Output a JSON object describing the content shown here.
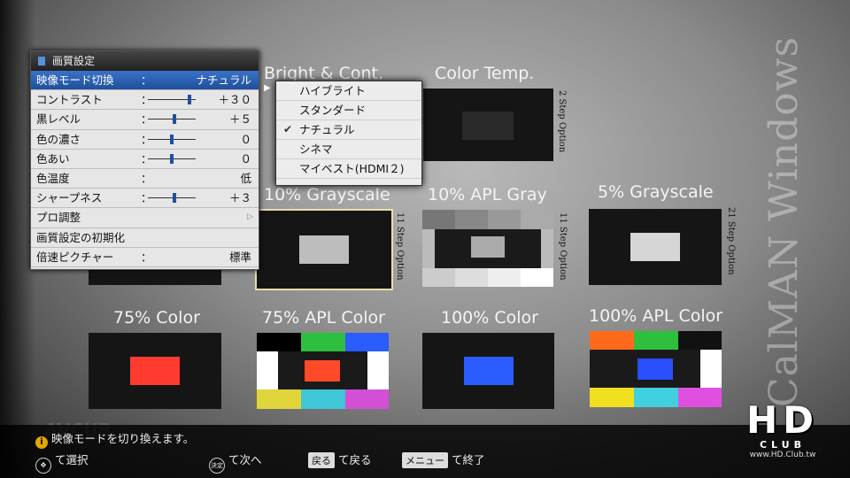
{
  "watermark": "CalMAN Windows",
  "patterns": [
    {
      "title": "Bright & Cont.",
      "option": ""
    },
    {
      "title": "Color Temp.",
      "option": "2 Step Option"
    },
    {
      "title": "10% Grayscale",
      "option": "11 Step Option"
    },
    {
      "title": "10% APL Gray",
      "option": "11 Step Option"
    },
    {
      "title": "5% Grayscale",
      "option": "21 Step Option"
    },
    {
      "title": "75% Color",
      "option": ""
    },
    {
      "title": "75% APL Color",
      "option": ""
    },
    {
      "title": "100% Color",
      "option": ""
    },
    {
      "title": "100% APL Color",
      "option": ""
    }
  ],
  "menu": {
    "title": "画質設定",
    "items": [
      {
        "label": "映像モード切換",
        "colon": "：",
        "value": "ナチュラル",
        "selected": true
      },
      {
        "label": "コントラスト",
        "colon": "：",
        "value": "＋３０",
        "slider": 0.9
      },
      {
        "label": "黒レベル",
        "colon": "：",
        "value": "＋５",
        "slider": 0.55
      },
      {
        "label": "色の濃さ",
        "colon": "：",
        "value": "０",
        "slider": 0.5
      },
      {
        "label": "色あい",
        "colon": "：",
        "value": "０",
        "slider": 0.5
      },
      {
        "label": "色温度",
        "colon": "：",
        "value": "低"
      },
      {
        "label": "シャープネス",
        "colon": "：",
        "value": "＋３",
        "slider": 0.55
      },
      {
        "label": "プロ調整",
        "colon": "",
        "value": "",
        "submenu": true
      },
      {
        "label": "画質設定の初期化",
        "colon": "",
        "value": ""
      },
      {
        "label": "倍速ピクチャー",
        "colon": "：",
        "value": "標準"
      }
    ]
  },
  "dropdown": {
    "options": [
      {
        "label": "ハイブライト",
        "checked": false
      },
      {
        "label": "スタンダード",
        "checked": false
      },
      {
        "label": "ナチュラル",
        "checked": true
      },
      {
        "label": "シネマ",
        "checked": false
      },
      {
        "label": "マイベスト(HDMI２)",
        "checked": false
      }
    ]
  },
  "status": {
    "message": "映像モードを切り換えます。",
    "info_icon": "i",
    "nav": {
      "select_text": "て選択",
      "enter_key": "決定",
      "enter_text": "て次へ",
      "back_key": "戻る",
      "back_text": "て戻る",
      "menu_key": "メニュー",
      "menu_text": "て終了"
    }
  },
  "logo": {
    "main": "HD",
    "sub": "CLUB",
    "url": "www.HD.Club.tw"
  },
  "bg_label": "AVCUB",
  "colors": {
    "accent": "#1f4f9a",
    "red": "#ff3b2f",
    "blue": "#2a5cff",
    "green": "#2fbf3f",
    "yellow": "#e0d53a",
    "cyan": "#3fc6d8",
    "magenta": "#d24fd6",
    "orange": "#ff6a1a"
  }
}
